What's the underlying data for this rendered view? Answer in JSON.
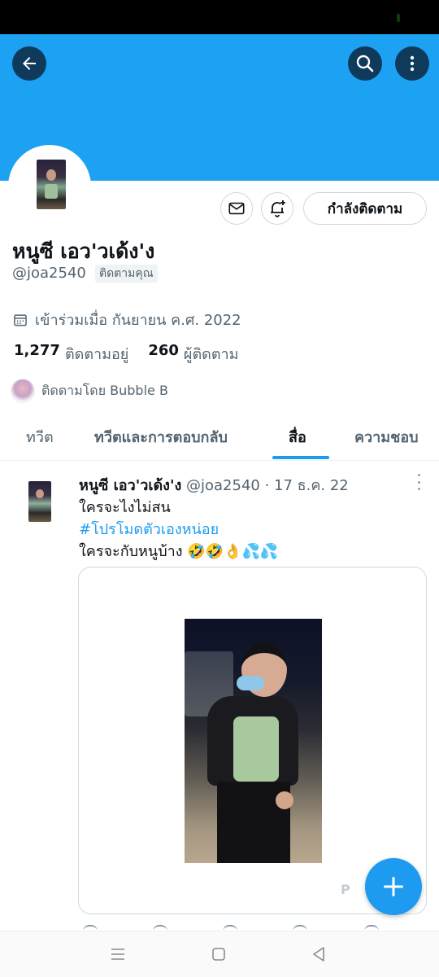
{
  "profile": {
    "name": "หนูซี เอว'วเด้ง'ง",
    "handle": "@joa2540",
    "follows_you_badge": "ติดตามคุณ",
    "joined": "เข้าร่วมเมื่อ กันยายน ค.ศ. 2022",
    "following_count": "1,277",
    "following_label": "ติดตามอยู่",
    "followers_count": "260",
    "followers_label": "ผู้ติดตาม",
    "followed_by": "ติดตามโดย Bubble B",
    "follow_button": "กำลังติดตาม"
  },
  "tabs": [
    {
      "label": "ทวีต"
    },
    {
      "label": "ทวีตและการตอบกลับ"
    },
    {
      "label": "สื่อ"
    },
    {
      "label": "ความชอบ"
    }
  ],
  "active_tab": "สื่อ",
  "tweet": {
    "author_name": "หนูซี เอว'วเด้ง'ง",
    "meta": "@joa2540 · 17 ธ.ค. 22",
    "line1": "ใครจะไงไม่สน",
    "hashtag": "#โปรโมดตัวเองหน่อย",
    "line3": "ใครจะกับหนูบ้าง 🤣🤣👌💦💦",
    "watermark": "P"
  },
  "icons": {
    "back": "back-arrow-icon",
    "search": "search-icon",
    "more": "more-vertical-icon",
    "message": "mail-icon",
    "notify": "bell-plus-icon",
    "calendar": "calendar-icon",
    "compose": "plus-icon"
  },
  "colors": {
    "accent": "#1d9bf0",
    "banner": "#1da1f2",
    "header_button": "#0f3a5c",
    "secondary_text": "#536471"
  }
}
